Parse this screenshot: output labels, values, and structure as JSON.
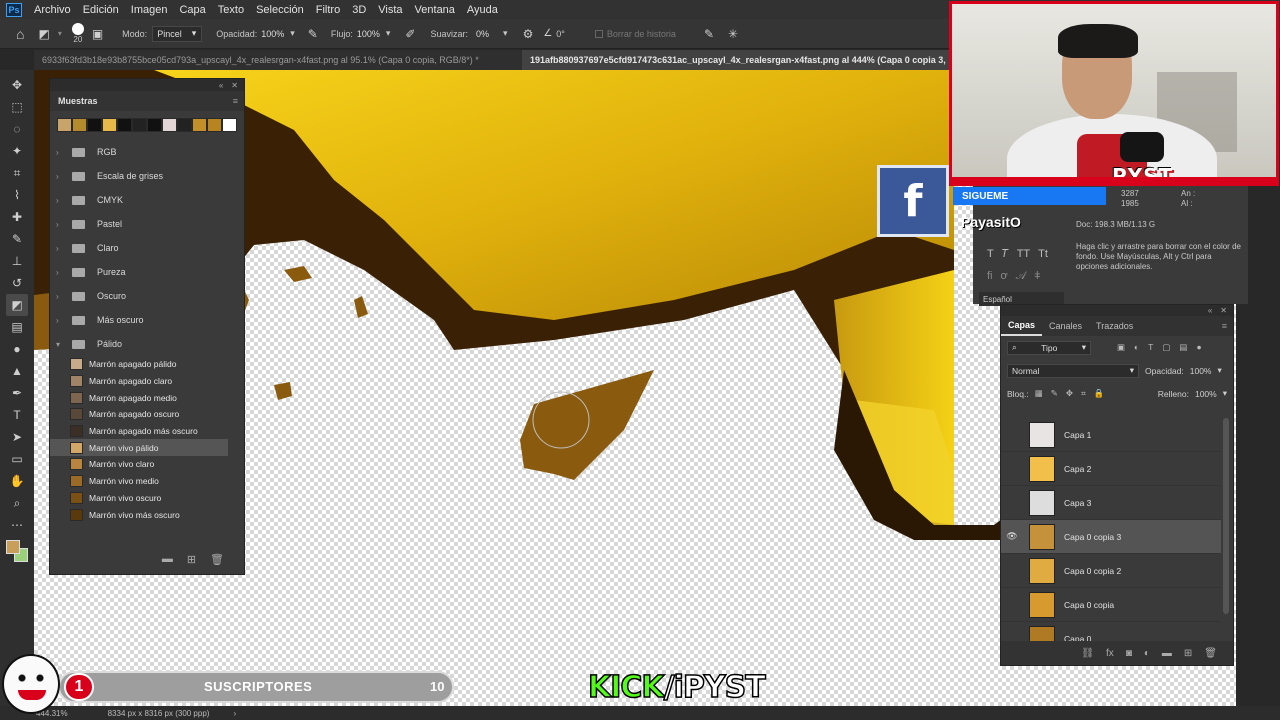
{
  "menu": [
    "Archivo",
    "Edición",
    "Imagen",
    "Capa",
    "Texto",
    "Selección",
    "Filtro",
    "3D",
    "Vista",
    "Ventana",
    "Ayuda"
  ],
  "ps_logo": "Ps",
  "options": {
    "brush_size": "20",
    "mode_label": "Modo:",
    "mode_value": "Pincel",
    "opacity_label": "Opacidad:",
    "opacity_value": "100%",
    "flow_label": "Flujo:",
    "flow_value": "100%",
    "smooth_label": "Suavizar:",
    "smooth_value": "0%",
    "angle_value": "0°",
    "history_label": "Borrar de historia"
  },
  "tabs": [
    "6933f63fd3b18e93b8755bce05cd793a_upscayl_4x_realesrgan-x4fast.png al 95.1% (Capa 0 copia, RGB/8*) *",
    "191afb880937697e5cfd917473c631ac_upscayl_4x_realesrgan-x4fast.png al 444% (Capa 0 copia 3,"
  ],
  "swatches": {
    "title": "Muestras",
    "recent": [
      "#c9a46a",
      "#b58a2e",
      "#111111",
      "#e8b94a",
      "#111111",
      "#222222",
      "#111111",
      "#e4d6d6",
      "#222222",
      "#c38f2a",
      "#b88420",
      "#ffffff"
    ],
    "folders": [
      {
        "label": "RGB",
        "open": false
      },
      {
        "label": "Escala de grises",
        "open": false
      },
      {
        "label": "CMYK",
        "open": false
      },
      {
        "label": "Pastel",
        "open": false
      },
      {
        "label": "Claro",
        "open": false
      },
      {
        "label": "Pureza",
        "open": false
      },
      {
        "label": "Oscuro",
        "open": false
      },
      {
        "label": "Más oscuro",
        "open": false
      },
      {
        "label": "Pálido",
        "open": true
      }
    ],
    "palido": [
      {
        "label": "Marrón apagado pálido",
        "color": "#c7aa8a"
      },
      {
        "label": "Marrón apagado claro",
        "color": "#a08468"
      },
      {
        "label": "Marrón apagado medio",
        "color": "#7d6550"
      },
      {
        "label": "Marrón apagado oscuro",
        "color": "#594739"
      },
      {
        "label": "Marrón apagado más oscuro",
        "color": "#3b2f25"
      },
      {
        "label": "Marrón vivo pálido",
        "color": "#d3a866"
      },
      {
        "label": "Marrón vivo claro",
        "color": "#b88540"
      },
      {
        "label": "Marrón vivo medio",
        "color": "#9b6a26"
      },
      {
        "label": "Marrón vivo oscuro",
        "color": "#7b5015"
      },
      {
        "label": "Marrón vivo más oscuro",
        "color": "#5a3a0c"
      }
    ],
    "selected": "Marrón vivo pálido"
  },
  "webcam": {
    "overlay": "PYST"
  },
  "social": {
    "cta": "SIGUEME",
    "name": "PayasitO",
    "fb": "f"
  },
  "info": {
    "w": "3287",
    "h": "1985",
    "an": "An :",
    "al": "Al :",
    "doc": "Doc: 198.3 MB/1.13 G",
    "help": "Haga clic y arrastre para borrar con el color de fondo. Use Mayúsculas, Alt y Ctrl para opciones adicionales.",
    "lang": "Español"
  },
  "layers": {
    "tabs": [
      "Capas",
      "Canales",
      "Trazados"
    ],
    "filter": "Tipo",
    "blend": "Normal",
    "opacity_label": "Opacidad:",
    "opacity_value": "100%",
    "lock_label": "Bloq.:",
    "fill_label": "Relleno:",
    "fill_value": "100%",
    "items": [
      {
        "name": "Capa 1",
        "visible": false,
        "thumb": "#e9e4e4"
      },
      {
        "name": "Capa 2",
        "visible": false,
        "thumb": "#f2bf4a"
      },
      {
        "name": "Capa 3",
        "visible": false,
        "thumb": "#dddddd"
      },
      {
        "name": "Capa 0 copia 3",
        "visible": true,
        "thumb": "#c5913a",
        "selected": true
      },
      {
        "name": "Capa 0 copia 2",
        "visible": false,
        "thumb": "#e0ab40"
      },
      {
        "name": "Capa 0 copia",
        "visible": false,
        "thumb": "#d69a2e"
      },
      {
        "name": "Capa 0",
        "visible": false,
        "thumb": "#b07a25"
      }
    ]
  },
  "status": {
    "zoom": "444.31%",
    "doc_size": "8334 px x 8316 px (300 ppp)"
  },
  "stream": {
    "sub_count": "1",
    "sub_label": "SUSCRIPTORES",
    "sub_goal": "10",
    "kick": "KICK",
    "handle": "/iPYST"
  }
}
